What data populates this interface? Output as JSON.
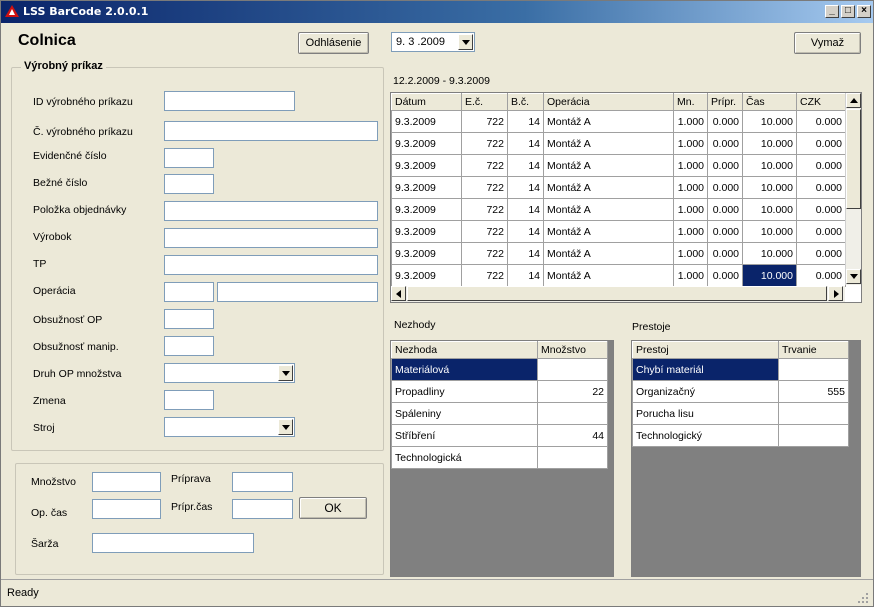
{
  "window": {
    "title": "LSS BarCode 2.0.0.1",
    "min": "_",
    "max": "□",
    "close": "×"
  },
  "header": {
    "title": "Colnica",
    "logout_label": "Odhlásenie",
    "date_value": "9. 3 .2009",
    "clear_label": "Vymaž"
  },
  "order_group": {
    "title": "Výrobný príkaz",
    "labels": {
      "id": "ID výrobného príkazu",
      "number": "Č. výrobného príkazu",
      "evidence": "Evidenčné číslo",
      "serial": "Bežné číslo",
      "item": "Položka objednávky",
      "product": "Výrobok",
      "tp": "TP",
      "operation": "Operácia",
      "occupancy_op": "Obsužnosť OP",
      "occupancy_manip": "Obsužnosť manip.",
      "op_type": "Druh OP množstva",
      "shift": "Zmena",
      "machine": "Stroj"
    }
  },
  "bottom_panel": {
    "qty_label": "Množstvo",
    "prep_label": "Príprava",
    "op_time_label": "Op. čas",
    "prep_time_label": "Prípr.čas",
    "ok_label": "OK",
    "batch_label": "Šarža"
  },
  "operations": {
    "date_range": "12.2.2009 - 9.3.2009",
    "columns": [
      "Dátum",
      "E.č.",
      "B.č.",
      "Operácia",
      "Mn.",
      "Prípr.",
      "Čas",
      "CZK"
    ],
    "rows": [
      [
        "9.3.2009",
        "722",
        "14",
        "Montáž A",
        "1.000",
        "0.000",
        "10.000",
        "0.000"
      ],
      [
        "9.3.2009",
        "722",
        "14",
        "Montáž A",
        "1.000",
        "0.000",
        "10.000",
        "0.000"
      ],
      [
        "9.3.2009",
        "722",
        "14",
        "Montáž A",
        "1.000",
        "0.000",
        "10.000",
        "0.000"
      ],
      [
        "9.3.2009",
        "722",
        "14",
        "Montáž A",
        "1.000",
        "0.000",
        "10.000",
        "0.000"
      ],
      [
        "9.3.2009",
        "722",
        "14",
        "Montáž A",
        "1.000",
        "0.000",
        "10.000",
        "0.000"
      ],
      [
        "9.3.2009",
        "722",
        "14",
        "Montáž A",
        "1.000",
        "0.000",
        "10.000",
        "0.000"
      ],
      [
        "9.3.2009",
        "722",
        "14",
        "Montáž A",
        "1.000",
        "0.000",
        "10.000",
        "0.000"
      ],
      [
        "9.3.2009",
        "722",
        "14",
        "Montáž A",
        "1.000",
        "0.000",
        "10.000",
        "0.000"
      ]
    ]
  },
  "defects": {
    "title": "Nezhody",
    "columns": [
      "Nezhoda",
      "Množstvo"
    ],
    "rows": [
      [
        "Materiálová",
        ""
      ],
      [
        "Propadliny",
        "22"
      ],
      [
        "Spáleniny",
        ""
      ],
      [
        "Stříbření",
        "44"
      ],
      [
        "Technologická",
        ""
      ]
    ]
  },
  "downtimes": {
    "title": "Prestoje",
    "columns": [
      "Prestoj",
      "Trvanie"
    ],
    "rows": [
      [
        "Chybí materiál",
        ""
      ],
      [
        "Organizačný",
        "555"
      ],
      [
        "Porucha lisu",
        ""
      ],
      [
        "Technologický",
        ""
      ]
    ]
  },
  "status": {
    "text": "Ready"
  },
  "colors": {
    "selection": "#0a246a",
    "title_bar": "#0a246a",
    "window_bg": "#ece9d8"
  }
}
